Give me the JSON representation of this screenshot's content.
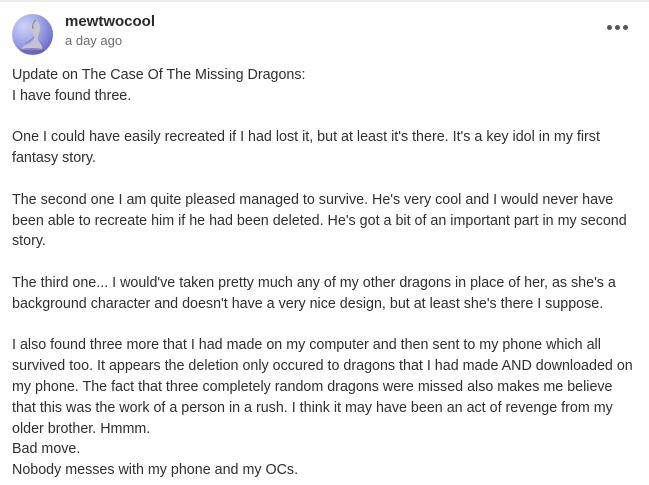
{
  "post": {
    "author": "mewtwocool",
    "timestamp": "a day ago",
    "lines": [
      "Update on The Case Of The Missing Dragons:",
      "I have found three.",
      "",
      "One I could have easily recreated if I had lost it, but at least it's there. It's a key idol in my first fantasy story.",
      "",
      "The second one I am quite pleased managed to survive. He's very cool and I would never have been able to recreate him if he had been deleted. He's got a bit of an important part in my second story.",
      "",
      "The third one... I would've taken pretty much any of my other dragons in place of her, as she's a background character and doesn't have a very nice design, but at least she's there I suppose.",
      "",
      "I also found three more that I had made on my computer and then sent to my phone which all survived too. It appears the deletion only occured to dragons that I had made AND downloaded on my phone. The fact that three completely random dragons were missed also makes me believe that this was the work of a person in a rush. I think it may have been an act of revenge from my older brother. Hmmm.",
      "Bad move.",
      "Nobody messes with my phone and my OCs."
    ]
  },
  "icons": {
    "avatar": "dragon-avatar-icon",
    "more": "more-options-icon"
  },
  "colors": {
    "text": "#2f2f2f",
    "muted": "#6d6d6d",
    "avatar_bg": "#8f95e0"
  }
}
